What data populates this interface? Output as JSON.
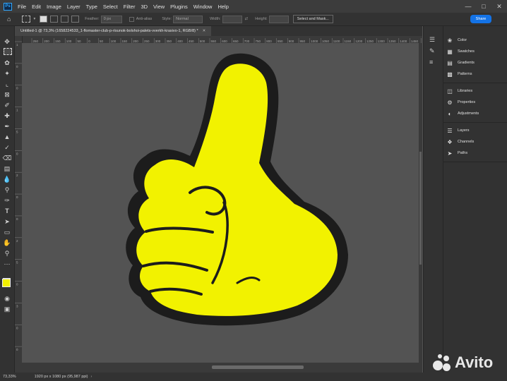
{
  "app": {
    "logo_text": "Ps"
  },
  "menu": [
    "File",
    "Edit",
    "Image",
    "Layer",
    "Type",
    "Select",
    "Filter",
    "3D",
    "View",
    "Plugins",
    "Window",
    "Help"
  ],
  "options": {
    "feather_label": "Feather:",
    "feather_value": "0 px",
    "antialias_label": "Anti-alias",
    "style_label": "Style:",
    "style_value": "Normal",
    "width_label": "Width:",
    "height_label": "Height:",
    "select_mask_button": "Select and Mask...",
    "share_button": "Share"
  },
  "document": {
    "tab_title": "Untitled-1 @ 73,3% (1658224533_1-flomaster-club-p-risunok-bolshoi-palets-vverkh-krasivo-1, RGB/8) *",
    "image_fill_color": "#f2f200",
    "image_outline_color": "#1c1c1c"
  },
  "ruler": {
    "top_ticks": [
      "250",
      "200",
      "150",
      "100",
      "50",
      "0",
      "50",
      "100",
      "150",
      "200",
      "250",
      "300",
      "350",
      "400",
      "450",
      "500",
      "550",
      "600",
      "650",
      "700",
      "750",
      "800",
      "850",
      "900",
      "950",
      "1000",
      "1050",
      "1100",
      "1150",
      "1200",
      "1250",
      "1300",
      "1350",
      "1400",
      "1450",
      "1500"
    ],
    "left_ticks": [
      "1",
      "0",
      "0",
      "1",
      "5",
      "0",
      "2",
      "0",
      "0",
      "2",
      "5",
      "0",
      "3",
      "0",
      "0"
    ]
  },
  "status": {
    "zoom": "73,33%",
    "doc_info": "1920 px x 1080 px (95,987 ppi)"
  },
  "panels": {
    "group1": [
      "Color",
      "Swatches",
      "Gradients",
      "Patterns"
    ],
    "group2": [
      "Libraries",
      "Properties",
      "Adjustments"
    ],
    "group3": [
      "Layers",
      "Channels",
      "Paths"
    ]
  },
  "colors": {
    "foreground": "#f2f000",
    "background": "#ffffff",
    "accent": "#1473e6"
  },
  "watermark": {
    "text": "Avito"
  }
}
